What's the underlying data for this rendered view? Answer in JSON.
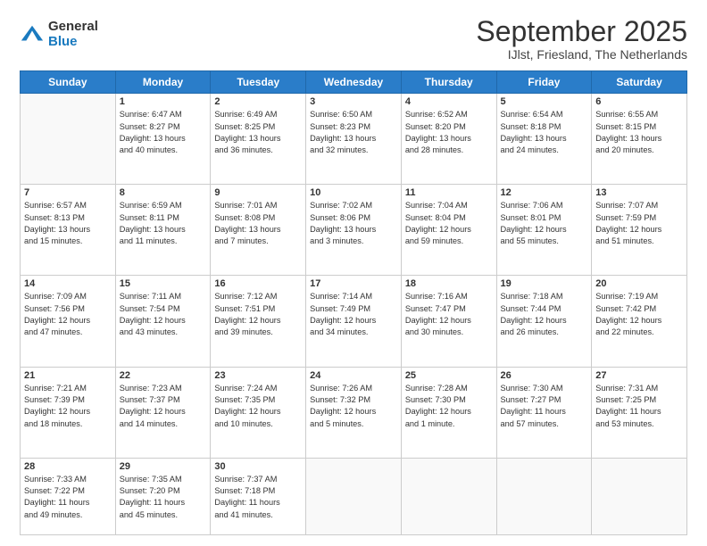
{
  "header": {
    "logo_general": "General",
    "logo_blue": "Blue",
    "month_title": "September 2025",
    "location": "IJlst, Friesland, The Netherlands"
  },
  "days_of_week": [
    "Sunday",
    "Monday",
    "Tuesday",
    "Wednesday",
    "Thursday",
    "Friday",
    "Saturday"
  ],
  "weeks": [
    [
      {
        "day": "",
        "info": ""
      },
      {
        "day": "1",
        "info": "Sunrise: 6:47 AM\nSunset: 8:27 PM\nDaylight: 13 hours\nand 40 minutes."
      },
      {
        "day": "2",
        "info": "Sunrise: 6:49 AM\nSunset: 8:25 PM\nDaylight: 13 hours\nand 36 minutes."
      },
      {
        "day": "3",
        "info": "Sunrise: 6:50 AM\nSunset: 8:23 PM\nDaylight: 13 hours\nand 32 minutes."
      },
      {
        "day": "4",
        "info": "Sunrise: 6:52 AM\nSunset: 8:20 PM\nDaylight: 13 hours\nand 28 minutes."
      },
      {
        "day": "5",
        "info": "Sunrise: 6:54 AM\nSunset: 8:18 PM\nDaylight: 13 hours\nand 24 minutes."
      },
      {
        "day": "6",
        "info": "Sunrise: 6:55 AM\nSunset: 8:15 PM\nDaylight: 13 hours\nand 20 minutes."
      }
    ],
    [
      {
        "day": "7",
        "info": "Sunrise: 6:57 AM\nSunset: 8:13 PM\nDaylight: 13 hours\nand 15 minutes."
      },
      {
        "day": "8",
        "info": "Sunrise: 6:59 AM\nSunset: 8:11 PM\nDaylight: 13 hours\nand 11 minutes."
      },
      {
        "day": "9",
        "info": "Sunrise: 7:01 AM\nSunset: 8:08 PM\nDaylight: 13 hours\nand 7 minutes."
      },
      {
        "day": "10",
        "info": "Sunrise: 7:02 AM\nSunset: 8:06 PM\nDaylight: 13 hours\nand 3 minutes."
      },
      {
        "day": "11",
        "info": "Sunrise: 7:04 AM\nSunset: 8:04 PM\nDaylight: 12 hours\nand 59 minutes."
      },
      {
        "day": "12",
        "info": "Sunrise: 7:06 AM\nSunset: 8:01 PM\nDaylight: 12 hours\nand 55 minutes."
      },
      {
        "day": "13",
        "info": "Sunrise: 7:07 AM\nSunset: 7:59 PM\nDaylight: 12 hours\nand 51 minutes."
      }
    ],
    [
      {
        "day": "14",
        "info": "Sunrise: 7:09 AM\nSunset: 7:56 PM\nDaylight: 12 hours\nand 47 minutes."
      },
      {
        "day": "15",
        "info": "Sunrise: 7:11 AM\nSunset: 7:54 PM\nDaylight: 12 hours\nand 43 minutes."
      },
      {
        "day": "16",
        "info": "Sunrise: 7:12 AM\nSunset: 7:51 PM\nDaylight: 12 hours\nand 39 minutes."
      },
      {
        "day": "17",
        "info": "Sunrise: 7:14 AM\nSunset: 7:49 PM\nDaylight: 12 hours\nand 34 minutes."
      },
      {
        "day": "18",
        "info": "Sunrise: 7:16 AM\nSunset: 7:47 PM\nDaylight: 12 hours\nand 30 minutes."
      },
      {
        "day": "19",
        "info": "Sunrise: 7:18 AM\nSunset: 7:44 PM\nDaylight: 12 hours\nand 26 minutes."
      },
      {
        "day": "20",
        "info": "Sunrise: 7:19 AM\nSunset: 7:42 PM\nDaylight: 12 hours\nand 22 minutes."
      }
    ],
    [
      {
        "day": "21",
        "info": "Sunrise: 7:21 AM\nSunset: 7:39 PM\nDaylight: 12 hours\nand 18 minutes."
      },
      {
        "day": "22",
        "info": "Sunrise: 7:23 AM\nSunset: 7:37 PM\nDaylight: 12 hours\nand 14 minutes."
      },
      {
        "day": "23",
        "info": "Sunrise: 7:24 AM\nSunset: 7:35 PM\nDaylight: 12 hours\nand 10 minutes."
      },
      {
        "day": "24",
        "info": "Sunrise: 7:26 AM\nSunset: 7:32 PM\nDaylight: 12 hours\nand 5 minutes."
      },
      {
        "day": "25",
        "info": "Sunrise: 7:28 AM\nSunset: 7:30 PM\nDaylight: 12 hours\nand 1 minute."
      },
      {
        "day": "26",
        "info": "Sunrise: 7:30 AM\nSunset: 7:27 PM\nDaylight: 11 hours\nand 57 minutes."
      },
      {
        "day": "27",
        "info": "Sunrise: 7:31 AM\nSunset: 7:25 PM\nDaylight: 11 hours\nand 53 minutes."
      }
    ],
    [
      {
        "day": "28",
        "info": "Sunrise: 7:33 AM\nSunset: 7:22 PM\nDaylight: 11 hours\nand 49 minutes."
      },
      {
        "day": "29",
        "info": "Sunrise: 7:35 AM\nSunset: 7:20 PM\nDaylight: 11 hours\nand 45 minutes."
      },
      {
        "day": "30",
        "info": "Sunrise: 7:37 AM\nSunset: 7:18 PM\nDaylight: 11 hours\nand 41 minutes."
      },
      {
        "day": "",
        "info": ""
      },
      {
        "day": "",
        "info": ""
      },
      {
        "day": "",
        "info": ""
      },
      {
        "day": "",
        "info": ""
      }
    ]
  ]
}
